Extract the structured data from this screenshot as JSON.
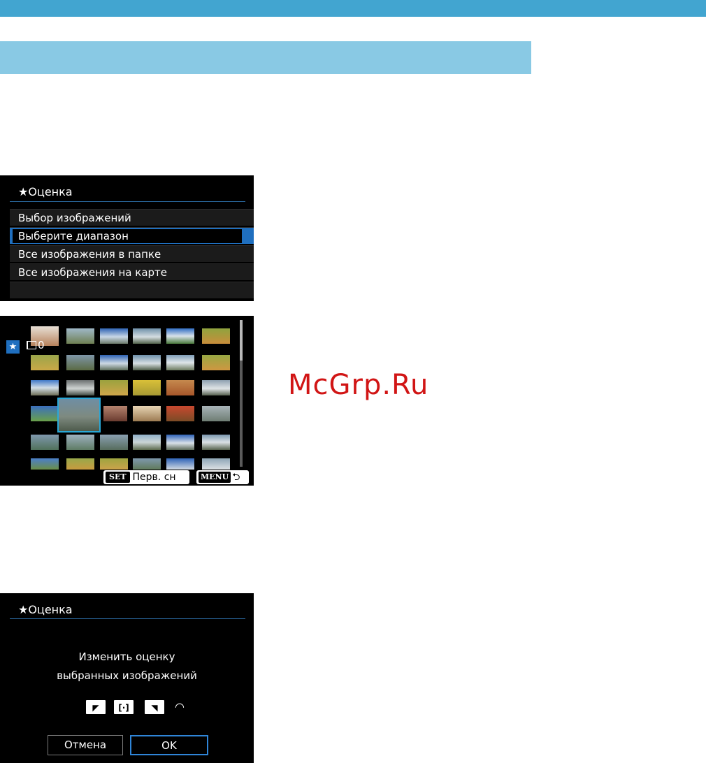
{
  "colors": {
    "top_bar": "#42a5d0",
    "sub_bar": "#89c9e4",
    "camera_bg": "#000000",
    "select_blue": "#1f6fbf",
    "watermark_red": "#d11515"
  },
  "menu_screen": {
    "title": "★Оценка",
    "items": [
      {
        "label": "Выбор изображений",
        "selected": false
      },
      {
        "label": "Выберите диапазон",
        "selected": true
      },
      {
        "label": "Все изображения в папке",
        "selected": false
      },
      {
        "label": "Все изображения на карте",
        "selected": false
      }
    ]
  },
  "grid_screen": {
    "rating_badge": "★",
    "selected_count": "0",
    "set_key": "SET",
    "set_label": "Перв. сн",
    "menu_key": "MENU",
    "back_icon": "back-arrow-icon"
  },
  "watermark": "McGrp.Ru",
  "confirm_screen": {
    "title": "★Оценка",
    "message_line1": "Изменить оценку",
    "message_line2": "выбранных изображений",
    "cancel_label": "Отмена",
    "ok_label": "OK"
  }
}
